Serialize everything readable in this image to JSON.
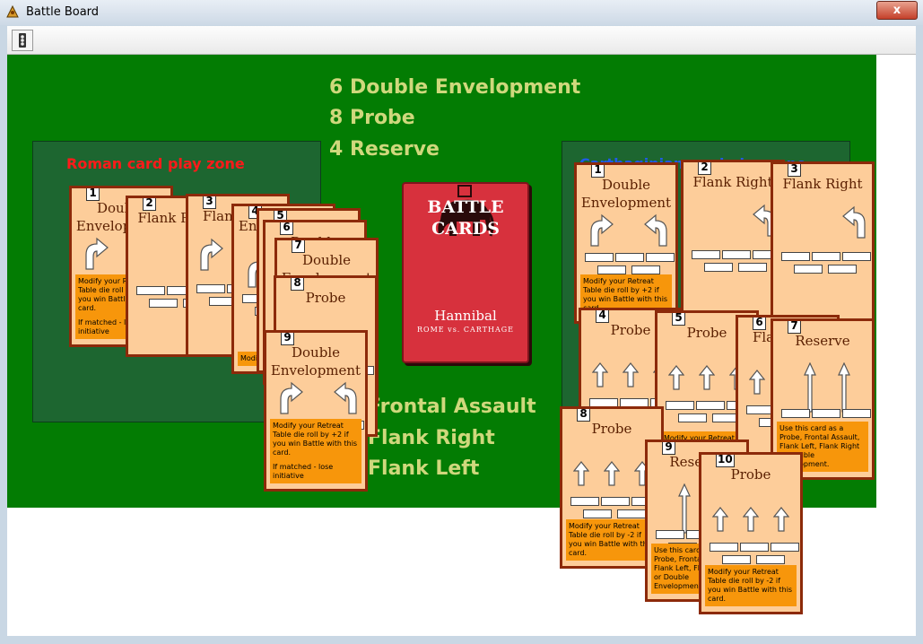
{
  "window": {
    "title": "Battle Board",
    "close_label": "x"
  },
  "board": {
    "roman_zone_label": "Roman card play zone",
    "carthaginian_zone_label": "Carthaginian card play zone",
    "colors": {
      "board": "#037c03",
      "zone": "#1d6630",
      "roman_label": "#ff1a1a",
      "carthaginian_label": "#1f5be8",
      "stats": "#cfd87c",
      "card": "#fdcd9a",
      "card_border": "#8c2a0a",
      "card_text_box": "#f7960b"
    },
    "counts_top": [
      "6 Double Envelopment",
      "8 Probe",
      "4 Reserve"
    ],
    "counts_bottom": [
      "Frontal Assault",
      "Flank Right",
      "Flank Left"
    ],
    "deck": {
      "title_line1": "BATTLE",
      "title_line2": "CARDS",
      "subtitle": "Hannibal",
      "subtitle2": "ROME vs. CARTHAGE"
    }
  },
  "roman_cards": [
    {
      "num": "1",
      "name": "Double Envelopment",
      "text": "Modify your Retreat Table die roll by +2 if you win Battle with this card.",
      "note": "If matched - lose initiative"
    },
    {
      "num": "2",
      "name": "Flank Right",
      "text": "",
      "note": ""
    },
    {
      "num": "3",
      "name": "Flank Left",
      "text": "",
      "note": ""
    },
    {
      "num": "4",
      "name": "Envelopment",
      "text": "Modify",
      "note": ""
    },
    {
      "num": "5",
      "name": "Double",
      "text": "",
      "note": ""
    },
    {
      "num": "6",
      "name": "Double",
      "text": "",
      "note": ""
    },
    {
      "num": "7",
      "name": "Double Envelopment",
      "text": "",
      "note": ""
    },
    {
      "num": "8",
      "name": "Probe",
      "text": "",
      "note": ""
    },
    {
      "num": "9",
      "name": "Double Envelopment",
      "text": "Modify your Retreat Table die roll by +2 if you win Battle with this card.",
      "note": "If matched - lose initiative"
    }
  ],
  "carthaginian_cards": [
    {
      "num": "1",
      "name": "Double Envelopment",
      "text": "Modify your Retreat Table die roll by +2 if you win Battle with this card.",
      "note": ""
    },
    {
      "num": "2",
      "name": "Flank Right",
      "text": "",
      "note": ""
    },
    {
      "num": "3",
      "name": "Flank Right",
      "text": "",
      "note": ""
    },
    {
      "num": "4",
      "name": "Probe",
      "text": "",
      "note": ""
    },
    {
      "num": "5",
      "name": "Probe",
      "text": "Modify your Retreat Table die roll by -2 if you win",
      "note": ""
    },
    {
      "num": "6",
      "name": "Flank Left",
      "text": "",
      "note": ""
    },
    {
      "num": "7",
      "name": "Reserve",
      "text": "Use this card as a Probe, Frontal Assault, Flank Left, Flank Right or Double Envelopment.",
      "note": ""
    },
    {
      "num": "8",
      "name": "Probe",
      "text": "Modify your Retreat Table die roll by -2 if you win Battle with this card.",
      "note": ""
    },
    {
      "num": "9",
      "name": "Reserve",
      "text": "Use this card as a Probe, Frontal Assault, Flank Left, Flank Right or Double Envelopment.",
      "note": ""
    },
    {
      "num": "10",
      "name": "Probe",
      "text": "Modify your Retreat Table die roll by -2 if you win Battle with this card.",
      "note": ""
    }
  ]
}
